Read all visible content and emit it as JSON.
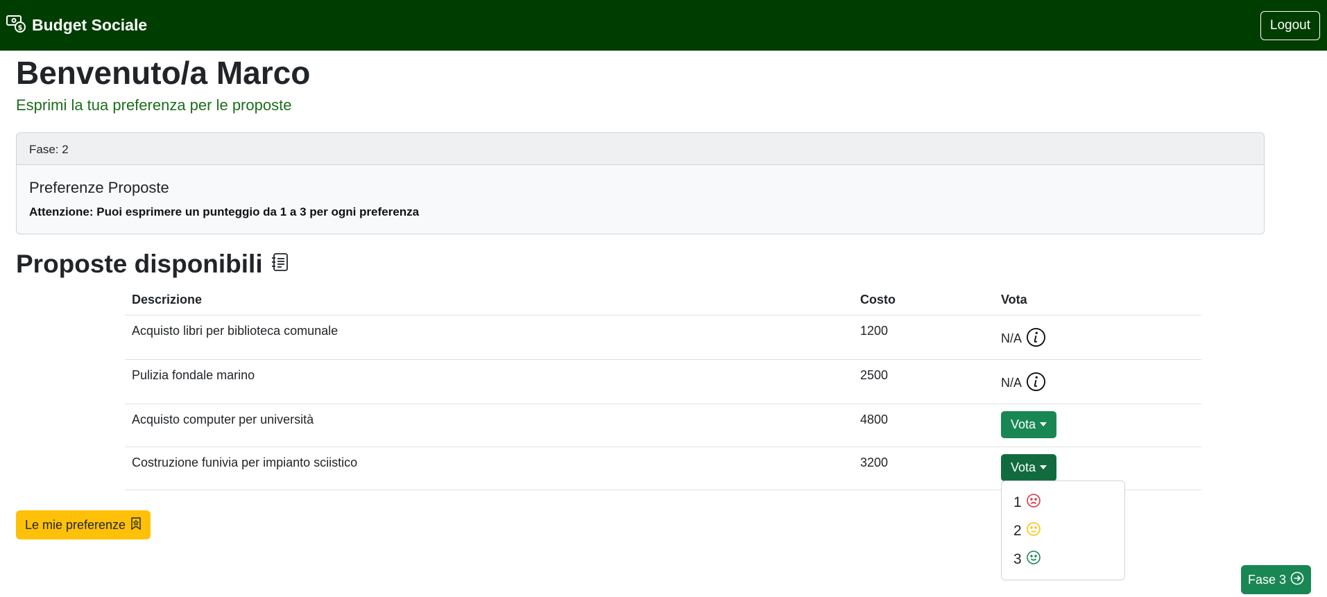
{
  "navbar": {
    "brand": "Budget Sociale",
    "brand_icon": "cash-coin-icon",
    "logout_label": "Logout",
    "bg_color": "#003d00"
  },
  "header": {
    "welcome": "Benvenuto/a Marco",
    "subtitle": "Esprimi la tua preferenza per le proposte"
  },
  "card": {
    "phase": "Fase: 2",
    "title": "Preferenze Proposte",
    "notice": "Attenzione: Puoi esprimere un punteggio da 1 a 3 per ogni preferenza"
  },
  "section": {
    "title": "Proposte disponibili",
    "icon": "journal-text-icon"
  },
  "table": {
    "headers": [
      "Descrizione",
      "Costo",
      "Vota"
    ],
    "rows": [
      {
        "description": "Acquisto libri per biblioteca comunale",
        "cost": "1200",
        "vote": "N/A"
      },
      {
        "description": "Pulizia fondale marino",
        "cost": "2500",
        "vote": "N/A"
      },
      {
        "description": "Acquisto computer per università",
        "cost": "4800",
        "vote_button": "Vota"
      },
      {
        "description": "Costruzione funivia per impianto sciistico",
        "cost": "3200",
        "vote_button": "Vota"
      }
    ]
  },
  "dropdown": {
    "items": [
      {
        "label": "1",
        "icon": "emoji-frown-icon",
        "color": "#dc3545"
      },
      {
        "label": "2",
        "icon": "emoji-neutral-icon",
        "color": "#ffc107"
      },
      {
        "label": "3",
        "icon": "emoji-smile-icon",
        "color": "#198754"
      }
    ]
  },
  "buttons": {
    "my_preferences": "Le mie preferenze",
    "next_phase": "Fase 3"
  },
  "colors": {
    "success": "#198754",
    "warning": "#ffc107",
    "danger": "#dc3545"
  }
}
